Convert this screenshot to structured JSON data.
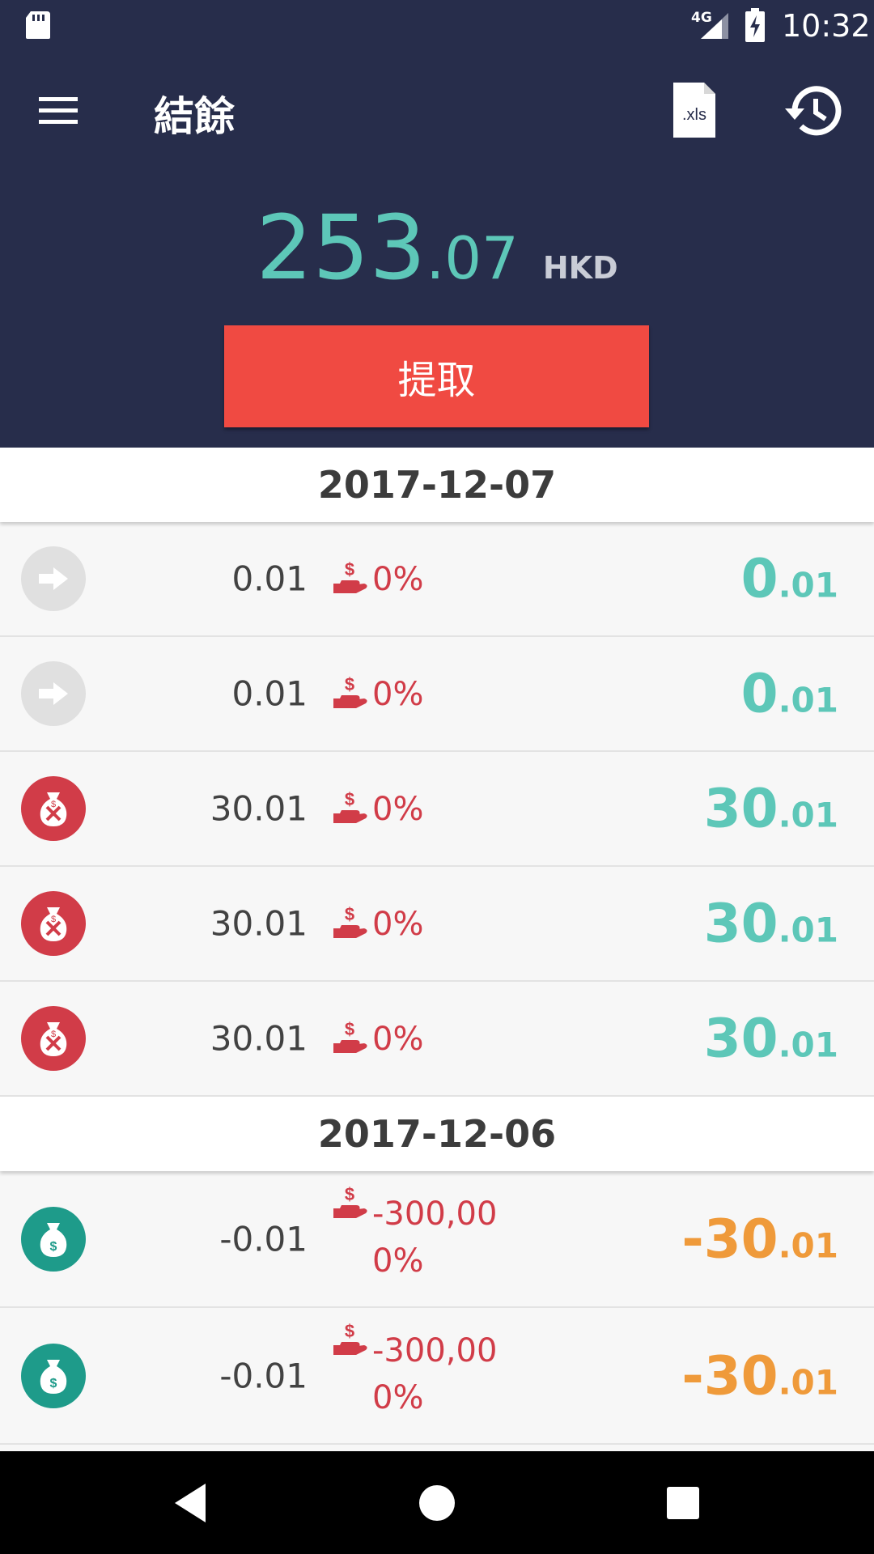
{
  "status_bar": {
    "network": "4G",
    "time": "10:32"
  },
  "app_bar": {
    "title": "結餘",
    "export_icon_label": ".xls"
  },
  "balance": {
    "integer": "253",
    "decimal": ".07",
    "currency": "HKD"
  },
  "withdraw_label": "提取",
  "colors": {
    "header_bg": "#272d4b",
    "accent_teal": "#5dc7b8",
    "withdraw_red": "#f04a42",
    "rate_red": "#d13c48",
    "negative_orange": "#ef9a3a",
    "icon_grey": "#e0e0e0",
    "icon_red": "#d13c48",
    "icon_green": "#1e9b8a"
  },
  "groups": [
    {
      "date": "2017-12-07",
      "rows": [
        {
          "icon": "arrow-right-icon",
          "amount": "0.01",
          "rate": "0%",
          "total_int": "0",
          "total_dec": ".01",
          "sign": "pos"
        },
        {
          "icon": "arrow-right-icon",
          "amount": "0.01",
          "rate": "0%",
          "total_int": "0",
          "total_dec": ".01",
          "sign": "pos"
        },
        {
          "icon": "cancelled-money-bag-icon",
          "amount": "30.01",
          "rate": "0%",
          "total_int": "30",
          "total_dec": ".01",
          "sign": "pos"
        },
        {
          "icon": "cancelled-money-bag-icon",
          "amount": "30.01",
          "rate": "0%",
          "total_int": "30",
          "total_dec": ".01",
          "sign": "pos"
        },
        {
          "icon": "cancelled-money-bag-icon",
          "amount": "30.01",
          "rate": "0%",
          "total_int": "30",
          "total_dec": ".01",
          "sign": "pos"
        }
      ]
    },
    {
      "date": "2017-12-06",
      "rows": [
        {
          "icon": "money-bag-icon",
          "amount": "-0.01",
          "rate": "-300,000%",
          "total_int": "-30",
          "total_dec": ".01",
          "sign": "neg"
        },
        {
          "icon": "money-bag-icon",
          "amount": "-0.01",
          "rate": "-300,000%",
          "total_int": "-30",
          "total_dec": ".01",
          "sign": "neg"
        }
      ]
    }
  ]
}
